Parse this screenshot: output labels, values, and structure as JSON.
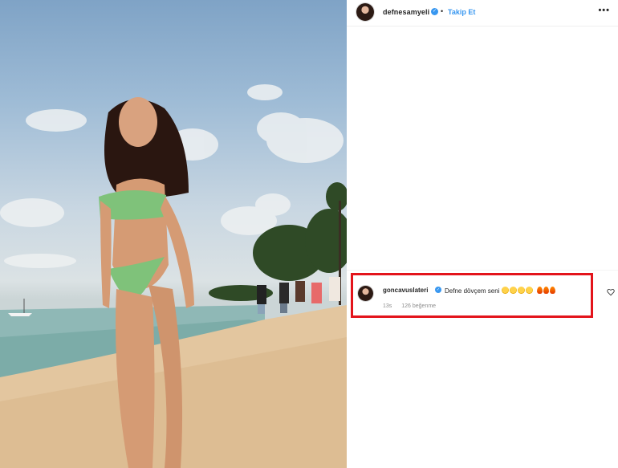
{
  "post": {
    "header": {
      "username": "defnesamyeli",
      "separator": "•",
      "follow_label": "Takip Et",
      "more_label": "•••",
      "avatar_icon": "profile-avatar-icon",
      "verified_icon": "verified-badge-icon"
    },
    "photo": {
      "description_icon": "beach-photo"
    },
    "comment": {
      "username": "goncavuslateri",
      "text": "Defne dövçem seni",
      "time": "13s",
      "likes": "126 beğenme",
      "emoji": [
        "smile",
        "smile",
        "smile",
        "smile",
        "fire",
        "fire",
        "fire"
      ]
    }
  },
  "colors": {
    "accent": "#3897f0",
    "highlight": "#e3141b",
    "text": "#262626",
    "muted": "#8e8e8e"
  }
}
